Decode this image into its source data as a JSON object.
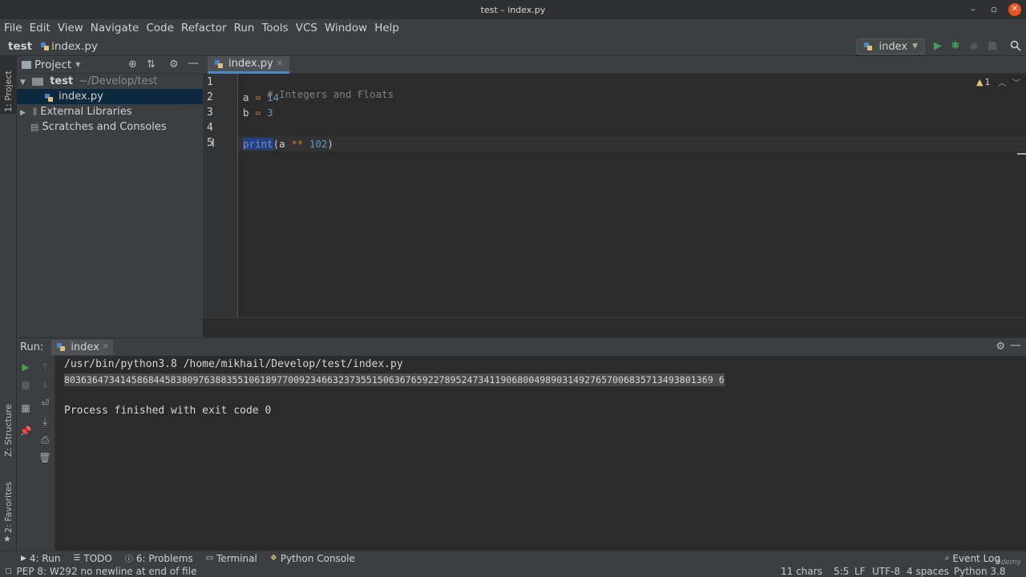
{
  "window": {
    "title": "test – index.py"
  },
  "menu": [
    "File",
    "Edit",
    "View",
    "Navigate",
    "Code",
    "Refactor",
    "Run",
    "Tools",
    "VCS",
    "Window",
    "Help"
  ],
  "breadcrumb": {
    "project": "test",
    "file": "index.py"
  },
  "run_config": {
    "label": "index"
  },
  "side_tabs": {
    "project": "1: Project",
    "structure": "Z: Structure",
    "favorites": "2: Favorites"
  },
  "project": {
    "header": "Project",
    "root_name": "test",
    "root_path": "~/Develop/test",
    "file": "index.py",
    "external": "External Libraries",
    "scratches": "Scratches and Consoles"
  },
  "editor": {
    "tab": "index.py",
    "warnings": "1",
    "lines": [
      "1",
      "2",
      "3",
      "4",
      "5"
    ],
    "code": {
      "comment": "# Integers and Floats",
      "a_var": "a",
      "a_eq": "=",
      "a_val": "14",
      "b_var": "b",
      "b_eq": "=",
      "b_val": "3",
      "print_fn": "print",
      "print_open": "(a ",
      "print_op": "**",
      "print_num": "102",
      "print_close": ")"
    }
  },
  "run_panel": {
    "label": "Run:",
    "tab": "index",
    "command": "/usr/bin/python3.8 /home/mikhail/Develop/test/index.py",
    "output": "80363647341458684458380976388355106189770092346632373551506367659227895247341190680049890314927657006835713493801369 6",
    "exit": "Process finished with exit code 0"
  },
  "tool_windows": [
    "4: Run",
    "TODO",
    "6: Problems",
    "Terminal",
    "Python Console"
  ],
  "event_log": "Event Log",
  "status": {
    "message": "PEP 8: W292 no newline at end of file",
    "chars": "11 chars",
    "position": "5:5",
    "line_sep": "LF",
    "encoding": "UTF-8",
    "indent": "4 spaces",
    "interpreter": "Python 3.8"
  },
  "watermark": "Udemy",
  "colors": {
    "keyword": "#cc7832",
    "number": "#6897bb",
    "comment": "#808080",
    "builtin": "#8888c6",
    "accent": "#4a88c7",
    "run_green": "#499c54"
  }
}
